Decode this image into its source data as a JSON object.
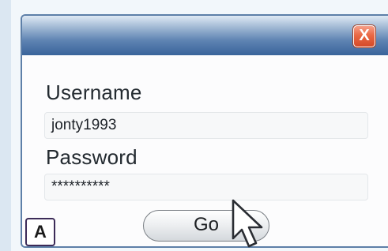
{
  "dialog": {
    "close_glyph": "X",
    "username_label": "Username",
    "username_value": "jonty1993",
    "password_label": "Password",
    "password_value": "**********",
    "go_label": "Go",
    "badge_text": "A"
  },
  "icons": {
    "close": "close-icon",
    "cursor": "mouse-pointer-icon"
  },
  "colors": {
    "titlebar": "#4f78ab",
    "close_button": "#e15f3d",
    "border": "#5d7fa8"
  }
}
